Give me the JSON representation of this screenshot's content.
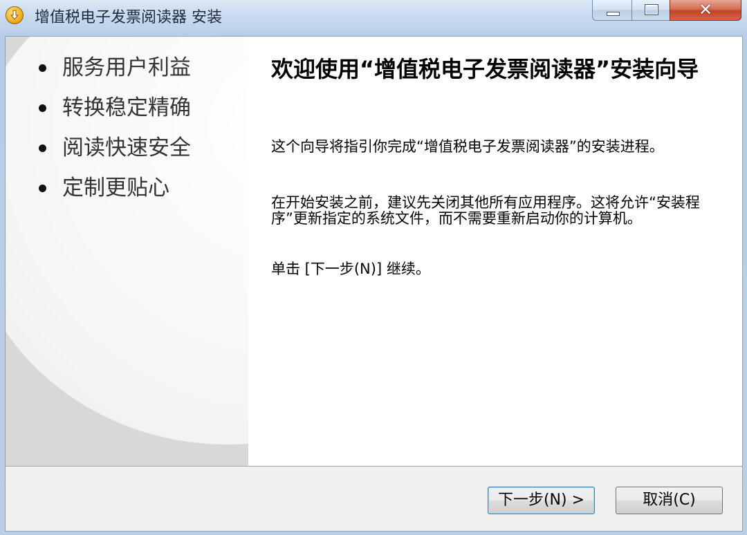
{
  "window": {
    "title": "增值税电子发票阅读器 安装",
    "icon": "installer-icon",
    "controls": {
      "minimize_icon": "minimize-icon",
      "maximize_icon": "maximize-icon",
      "close_glyph": "✕"
    }
  },
  "sidebar": {
    "features": [
      "服务用户利益",
      "转换稳定精确",
      "阅读快速安全",
      "定制更贴心"
    ]
  },
  "content": {
    "heading": "欢迎使用“增值税电子发票阅读器”安装向导",
    "paragraphs": [
      "这个向导将指引你完成“增值税电子发票阅读器”的安装进程。",
      "在开始安装之前，建议先关闭其他所有应用程序。这将允许“安装程序”更新指定的系统文件，而不需要重新启动你的计算机。",
      "单击 [下一步(N)] 继续。"
    ]
  },
  "footer": {
    "next_label": "下一步(N) >",
    "cancel_label": "取消(C)"
  },
  "colors": {
    "title_bar": "#c6d9ef",
    "close_button": "#c1432a",
    "focus_border": "#3c7fb1"
  }
}
